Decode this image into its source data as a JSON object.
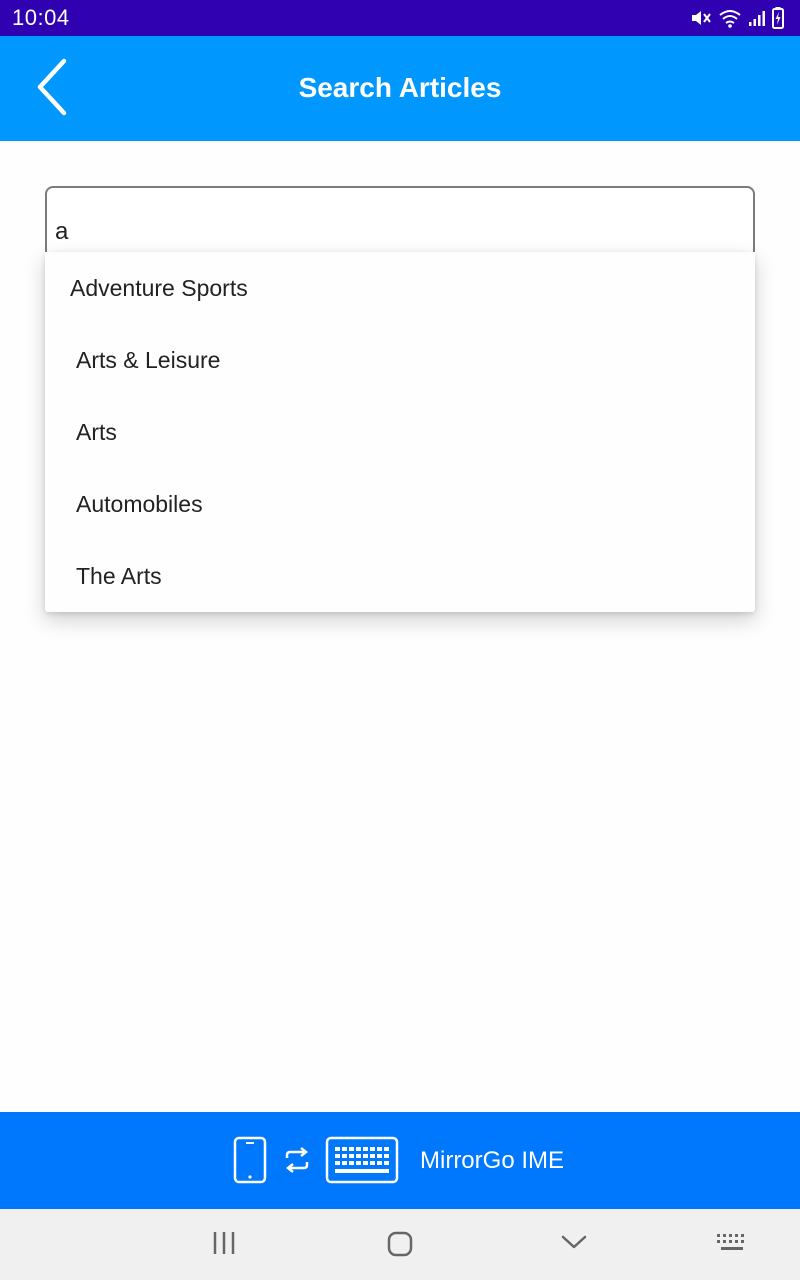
{
  "status_bar": {
    "time": "10:04",
    "icons": [
      "mute-icon",
      "wifi-icon",
      "signal-icon",
      "battery-charging-icon"
    ]
  },
  "app_bar": {
    "title": "Search Articles",
    "back_icon": "chevron-left-icon",
    "background": "#0098fe"
  },
  "search": {
    "value": "a"
  },
  "suggestions": [
    "Adventure Sports",
    "Arts & Leisure",
    "Arts",
    "Automobiles",
    "The Arts"
  ],
  "ime_bar": {
    "label": "MirrorGo IME",
    "icons": [
      "phone-icon",
      "swap-icon",
      "keyboard-icon"
    ],
    "background": "#0078fe"
  },
  "nav_bar": {
    "icons": [
      "recent-apps-icon",
      "home-icon",
      "hide-keyboard-icon",
      "keyboard-switch-icon"
    ]
  }
}
